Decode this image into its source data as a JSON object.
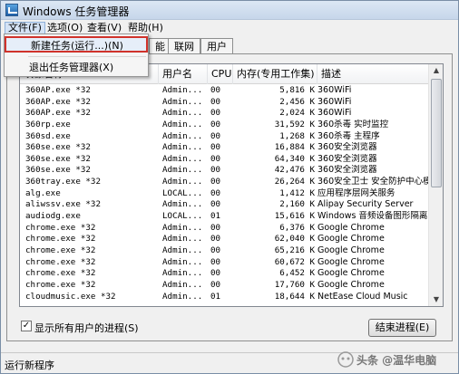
{
  "window": {
    "title": "Windows 任务管理器"
  },
  "menu": [
    "文件(F)",
    "选项(O)",
    "查看(V)",
    "帮助(H)"
  ],
  "file_menu": {
    "new_task": "新建任务(运行...)(N)",
    "exit": "退出任务管理器(X)"
  },
  "tabs": [
    "能",
    "联网",
    "用户"
  ],
  "columns": {
    "name": "映像名称",
    "user": "用户名",
    "cpu": "CPU",
    "mem": "内存(专用工作集)",
    "desc": "描述"
  },
  "processes": [
    {
      "name": "360AP.exe *32",
      "user": "Admin...",
      "cpu": "00",
      "mem": "5,816 K",
      "desc": "360WiFi"
    },
    {
      "name": "360AP.exe *32",
      "user": "Admin...",
      "cpu": "00",
      "mem": "2,456 K",
      "desc": "360WiFi"
    },
    {
      "name": "360AP.exe *32",
      "user": "Admin...",
      "cpu": "00",
      "mem": "2,024 K",
      "desc": "360WiFi"
    },
    {
      "name": "360rp.exe",
      "user": "Admin...",
      "cpu": "00",
      "mem": "31,592 K",
      "desc": "360杀毒 实时监控"
    },
    {
      "name": "360sd.exe",
      "user": "Admin...",
      "cpu": "00",
      "mem": "1,268 K",
      "desc": "360杀毒 主程序"
    },
    {
      "name": "360se.exe *32",
      "user": "Admin...",
      "cpu": "00",
      "mem": "16,884 K",
      "desc": "360安全浏览器"
    },
    {
      "name": "360se.exe *32",
      "user": "Admin...",
      "cpu": "00",
      "mem": "64,340 K",
      "desc": "360安全浏览器"
    },
    {
      "name": "360se.exe *32",
      "user": "Admin...",
      "cpu": "00",
      "mem": "42,476 K",
      "desc": "360安全浏览器"
    },
    {
      "name": "360tray.exe *32",
      "user": "Admin...",
      "cpu": "00",
      "mem": "26,264 K",
      "desc": "360安全卫士 安全防护中心模块"
    },
    {
      "name": "alg.exe",
      "user": "LOCAL...",
      "cpu": "00",
      "mem": "1,412 K",
      "desc": "应用程序层网关服务"
    },
    {
      "name": "aliwssv.exe *32",
      "user": "Admin...",
      "cpu": "00",
      "mem": "2,160 K",
      "desc": "Alipay Security Server"
    },
    {
      "name": "audiodg.exe",
      "user": "LOCAL...",
      "cpu": "01",
      "mem": "15,616 K",
      "desc": "Windows 音频设备图形隔离"
    },
    {
      "name": "chrome.exe *32",
      "user": "Admin...",
      "cpu": "00",
      "mem": "6,376 K",
      "desc": "Google Chrome"
    },
    {
      "name": "chrome.exe *32",
      "user": "Admin...",
      "cpu": "00",
      "mem": "62,040 K",
      "desc": "Google Chrome"
    },
    {
      "name": "chrome.exe *32",
      "user": "Admin...",
      "cpu": "00",
      "mem": "65,216 K",
      "desc": "Google Chrome"
    },
    {
      "name": "chrome.exe *32",
      "user": "Admin...",
      "cpu": "00",
      "mem": "60,672 K",
      "desc": "Google Chrome"
    },
    {
      "name": "chrome.exe *32",
      "user": "Admin...",
      "cpu": "00",
      "mem": "6,452 K",
      "desc": "Google Chrome"
    },
    {
      "name": "chrome.exe *32",
      "user": "Admin...",
      "cpu": "00",
      "mem": "17,760 K",
      "desc": "Google Chrome"
    },
    {
      "name": "cloudmusic.exe *32",
      "user": "Admin...",
      "cpu": "01",
      "mem": "18,644 K",
      "desc": "NetEase Cloud Music"
    }
  ],
  "show_all": {
    "label": "显示所有用户的进程(S)",
    "checked": true
  },
  "end_process": "结束进程(E)",
  "watermark": "头条 @温华电脑",
  "status": "运行新程序"
}
